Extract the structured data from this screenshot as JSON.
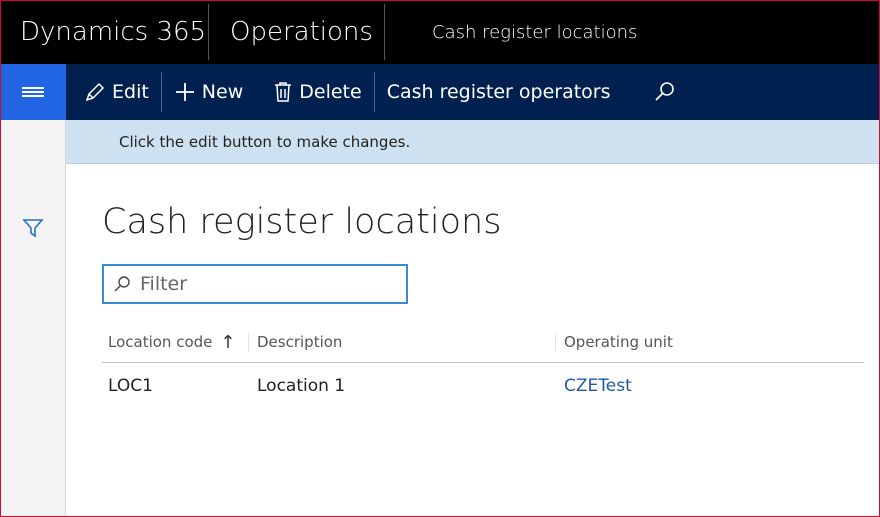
{
  "topbar": {
    "app_name": "Dynamics 365",
    "module": "Operations",
    "page_title": "Cash register locations"
  },
  "actionbar": {
    "menu_icon": "hamburger-icon",
    "edit_label": "Edit",
    "new_label": "New",
    "delete_label": "Delete",
    "operators_label": "Cash register operators",
    "search_icon": "search-icon"
  },
  "infobar": {
    "message": "Click the edit button to make changes."
  },
  "main": {
    "title": "Cash register locations",
    "filter": {
      "placeholder": "Filter",
      "value": ""
    },
    "grid": {
      "columns": [
        "Location code",
        "Description",
        "Operating unit"
      ],
      "sort_column": "Location code",
      "sort_direction": "ascending",
      "rows": [
        {
          "location_code": "LOC1",
          "description": "Location 1",
          "operating_unit": "CZETest"
        }
      ]
    }
  },
  "colors": {
    "topbar_bg": "#000000",
    "actionbar_bg": "#002050",
    "menu_button_bg": "#2266e3",
    "infobar_bg": "#cde1f1",
    "link": "#1e5aa8",
    "filter_border": "#3b8bd4"
  }
}
